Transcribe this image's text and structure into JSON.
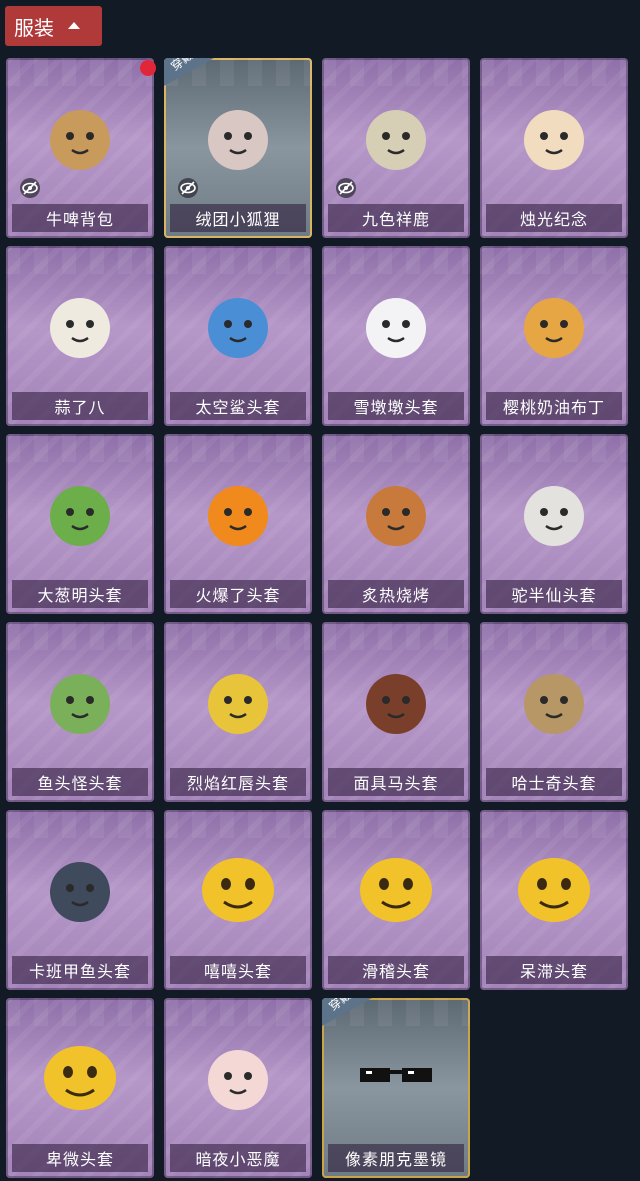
{
  "header": {
    "title": "服装"
  },
  "worn_label": "穿戴",
  "items": [
    {
      "name": "牛啤背包",
      "icon": "beer-cow-backpack-icon",
      "color": "#c89a5c",
      "hidden": true
    },
    {
      "name": "绒团小狐狸",
      "icon": "fluffy-fox-icon",
      "color": "#d9c7c4",
      "hidden": true,
      "worn": true,
      "selected": true
    },
    {
      "name": "九色祥鹿",
      "icon": "nine-color-deer-icon",
      "color": "#d6cfb5",
      "hidden": true
    },
    {
      "name": "烛光纪念",
      "icon": "candle-icon",
      "color": "#f1dcc0",
      "hidden": false
    },
    {
      "name": "蒜了八",
      "icon": "garlic-icon",
      "color": "#eeeadf",
      "hidden": false
    },
    {
      "name": "太空鲨头套",
      "icon": "space-shark-icon",
      "color": "#4a8fd6",
      "hidden": false
    },
    {
      "name": "雪墩墩头套",
      "icon": "snowman-icon",
      "color": "#f3f3f6",
      "hidden": false
    },
    {
      "name": "樱桃奶油布丁",
      "icon": "pudding-icon",
      "color": "#e7a644",
      "hidden": false
    },
    {
      "name": "大葱明头套",
      "icon": "scallion-icon",
      "color": "#6cae4a",
      "hidden": false
    },
    {
      "name": "火爆了头套",
      "icon": "fire-icon",
      "color": "#f08a1c",
      "hidden": false
    },
    {
      "name": "炙热烧烤",
      "icon": "bbq-meat-icon",
      "color": "#c87a3c",
      "hidden": false
    },
    {
      "name": "驼半仙头套",
      "icon": "bear-shades-icon",
      "color": "#e4e2de",
      "hidden": false
    },
    {
      "name": "鱼头怪头套",
      "icon": "fish-head-icon",
      "color": "#7bb05a",
      "hidden": false
    },
    {
      "name": "烈焰红唇头套",
      "icon": "red-lips-mask-icon",
      "color": "#e8c43a",
      "hidden": false
    },
    {
      "name": "面具马头套",
      "icon": "horse-mask-icon",
      "color": "#7a3f2a",
      "hidden": false
    },
    {
      "name": "哈士奇头套",
      "icon": "husky-icon",
      "color": "#b89766",
      "hidden": false
    },
    {
      "name": "卡班甲鱼头套",
      "icon": "whale-icon",
      "color": "#3f4a5c",
      "hidden": false
    },
    {
      "name": "嘻嘻头套",
      "icon": "grin-emoji-icon",
      "color": "#f2c22a",
      "hidden": false
    },
    {
      "name": "滑稽头套",
      "icon": "funny-emoji-icon",
      "color": "#f2c22a",
      "hidden": false
    },
    {
      "name": "呆滞头套",
      "icon": "dazed-emoji-icon",
      "color": "#f2c22a",
      "hidden": false
    },
    {
      "name": "卑微头套",
      "icon": "humble-emoji-icon",
      "color": "#f2c22a",
      "hidden": false
    },
    {
      "name": "暗夜小恶魔",
      "icon": "devil-icon",
      "color": "#f4d8d6",
      "hidden": false
    },
    {
      "name": "像素朋克墨镜",
      "icon": "pixel-sunglasses-icon",
      "color": "#111111",
      "hidden": false,
      "worn": true
    }
  ]
}
